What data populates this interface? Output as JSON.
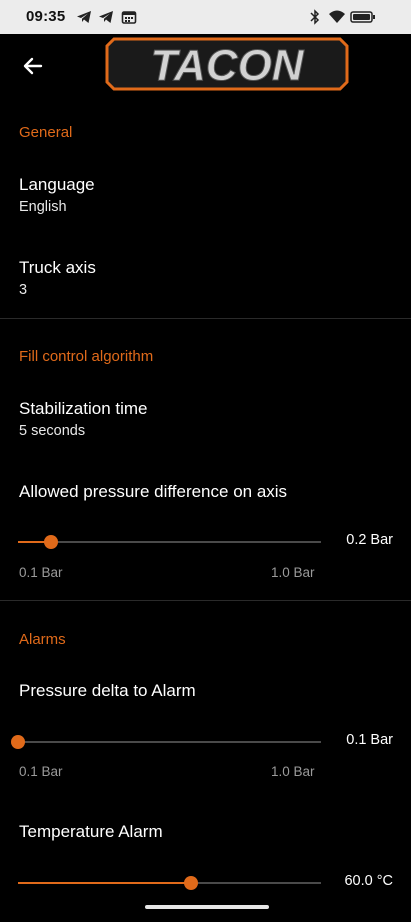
{
  "status_bar": {
    "time": "09:35",
    "left_icons": [
      "telegram-icon",
      "telegram-icon",
      "calendar-icon"
    ],
    "right_icons": [
      "bluetooth-icon",
      "wifi-icon",
      "battery-icon"
    ]
  },
  "app_bar": {
    "logo_text": "TACON"
  },
  "general": {
    "header": "General",
    "language": {
      "title": "Language",
      "value": "English"
    },
    "truck_axis": {
      "title": "Truck axis",
      "value": "3"
    }
  },
  "fill_control": {
    "header": "Fill control algorithm",
    "stabilization": {
      "title": "Stabilization time",
      "value": "5 seconds"
    },
    "pressure_diff": {
      "title": "Allowed pressure difference on axis",
      "value_label": "0.2 Bar",
      "min_label": "0.1 Bar",
      "max_label": "1.0 Bar",
      "fraction": 0.11
    }
  },
  "alarms": {
    "header": "Alarms",
    "pressure_delta": {
      "title": "Pressure delta to Alarm",
      "value_label": "0.1 Bar",
      "min_label": "0.1 Bar",
      "max_label": "1.0 Bar",
      "fraction": 0.0
    },
    "temperature": {
      "title": "Temperature Alarm",
      "value_label": "60.0 °C",
      "fraction": 0.57
    }
  },
  "colors": {
    "accent": "#e06a1a",
    "background": "#000000"
  }
}
